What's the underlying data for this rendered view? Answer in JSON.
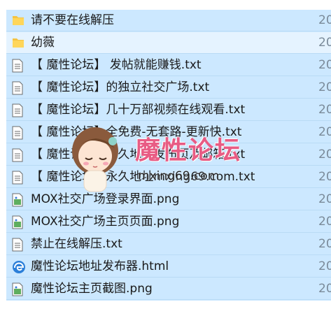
{
  "files": [
    {
      "name": "请不要在线解压",
      "type": "folder",
      "meta": "20"
    },
    {
      "name": "幼薇",
      "type": "folder",
      "meta": "20"
    },
    {
      "name": "【 魔性论坛】 发帖就能赚钱.txt",
      "type": "text",
      "meta": "20"
    },
    {
      "name": "【 魔性论坛】的独立社交广场.txt",
      "type": "text",
      "meta": "20"
    },
    {
      "name": "【 魔性论坛】几十万部视频在线观看.txt",
      "type": "text",
      "meta": "20"
    },
    {
      "name": "【 魔性论坛】全免费-无套路-更新快.txt",
      "type": "text",
      "meta": "20"
    },
    {
      "name": "【 魔性论坛】永久地址发布页及邮箱.txt",
      "type": "text",
      "meta": "20"
    },
    {
      "name": "【 魔性论坛】永久地址mxing69.com.txt",
      "type": "text",
      "meta": "20"
    },
    {
      "name": "MOX社交广场登录界面.png",
      "type": "image",
      "meta": "20"
    },
    {
      "name": "MOX社交广场主页页面.png",
      "type": "image",
      "meta": "20"
    },
    {
      "name": "禁止在线解压.txt",
      "type": "text",
      "meta": "20"
    },
    {
      "name": "魔性论坛地址发布器.html",
      "type": "html",
      "meta": "20"
    },
    {
      "name": "魔性论坛主页截图.png",
      "type": "image",
      "meta": "20"
    }
  ],
  "watermark": {
    "title": "魔性论坛",
    "url": "mxing69.com"
  },
  "colors": {
    "selected_row": "#cce8ff",
    "hover_row": "#e5f3ff",
    "folder": "#f5c342",
    "watermark_pink": "#e85c84",
    "edge_browser": "#2b7fd9"
  }
}
